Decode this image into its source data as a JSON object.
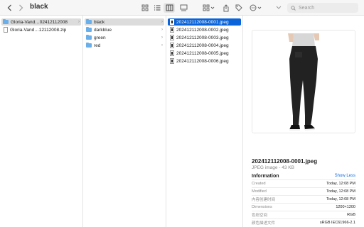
{
  "window": {
    "title": "black"
  },
  "toolbar": {
    "back_icon": "chevron-left-icon",
    "forward_icon": "chevron-right-icon",
    "search_placeholder": "Search"
  },
  "column1": {
    "items": [
      {
        "label": "Gloria-Vand…02412112008",
        "type": "folder",
        "selected": true
      },
      {
        "label": "Gloria-Vand…12112008.zip",
        "type": "zip",
        "selected": false
      }
    ]
  },
  "column2": {
    "items": [
      {
        "label": "black",
        "selected": true
      },
      {
        "label": "darkblue",
        "selected": false
      },
      {
        "label": "green",
        "selected": false
      },
      {
        "label": "red",
        "selected": false
      }
    ]
  },
  "column3": {
    "items": [
      {
        "label": "202412112008-0001.jpeg",
        "selected": true
      },
      {
        "label": "202412112008-0002.jpeg",
        "selected": false
      },
      {
        "label": "202412112008-0003.jpeg",
        "selected": false
      },
      {
        "label": "202412112008-0004.jpeg",
        "selected": false
      },
      {
        "label": "202412112008-0005.jpeg",
        "selected": false
      },
      {
        "label": "202412112008-0006.jpeg",
        "selected": false
      }
    ]
  },
  "preview": {
    "file_name": "202412112008-0001.jpeg",
    "file_kind": "JPEG image - 43 KB",
    "info_heading": "Information",
    "show_less": "Show Less",
    "info": [
      {
        "key": "Created",
        "value": "Today, 12:08 PM"
      },
      {
        "key": "Modified",
        "value": "Today, 12:08 PM"
      },
      {
        "key": "内容创建时间",
        "value": "Today, 12:08 PM"
      },
      {
        "key": "Dimensions",
        "value": "1200×1200"
      },
      {
        "key": "色彩空间",
        "value": "RGB"
      },
      {
        "key": "颜色描述文件",
        "value": "sRGB IEC61966-2.1"
      }
    ]
  },
  "colors": {
    "selection_blue": "#0a63d9",
    "selection_grey": "#dcdcdc",
    "link_blue": "#1a6fe0"
  }
}
